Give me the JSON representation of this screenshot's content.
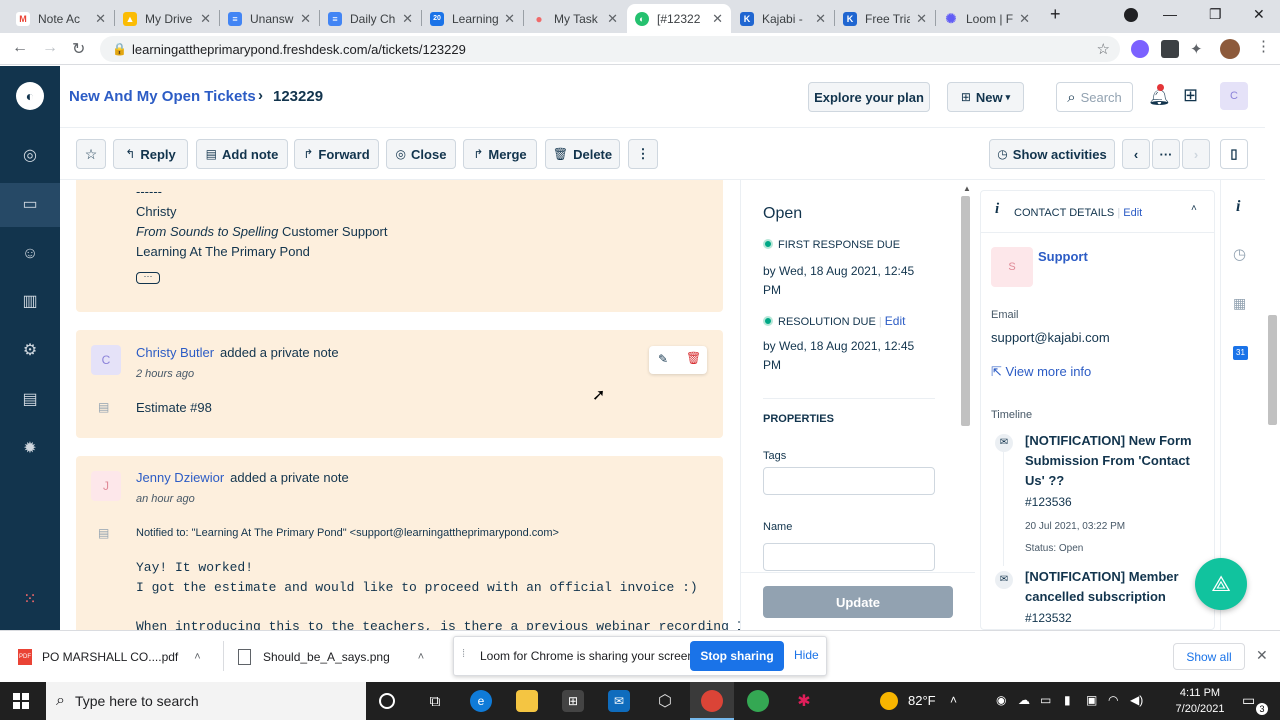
{
  "browser": {
    "tabs": [
      {
        "title": "Note Ac",
        "fav_color": "#ea4335",
        "fav": "M"
      },
      {
        "title": "My Drive",
        "fav_color": "#fbbc04",
        "fav": "▲"
      },
      {
        "title": "Unansw",
        "fav_color": "#4285f4",
        "fav": "≡"
      },
      {
        "title": "Daily Ch",
        "fav_color": "#4285f4",
        "fav": "≡"
      },
      {
        "title": "Learning",
        "fav_color": "#1a73e8",
        "fav": "20"
      },
      {
        "title": "My Task",
        "fav_color": "#f06a6a",
        "fav": "●"
      },
      {
        "title": "[#12322",
        "fav_color": "#25c16f",
        "fav": "◐"
      },
      {
        "title": "Kajabi -",
        "fav_color": "#2066d1",
        "fav": "K"
      },
      {
        "title": "Free Tria",
        "fav_color": "#2066d1",
        "fav": "K"
      },
      {
        "title": "Loom | F",
        "fav_color": "#625df5",
        "fav": "✺"
      }
    ],
    "url": "learningattheprimarypond.freshdesk.com/a/tickets/123229"
  },
  "header": {
    "breadcrumb": "New And My Open Tickets",
    "ticket_id": "123229",
    "explore_plan": "Explore your plan",
    "new_label": "New",
    "search_label": "Search",
    "avatar_letter": "C"
  },
  "toolbar": {
    "reply": "Reply",
    "add_note": "Add note",
    "forward": "Forward",
    "close": "Close",
    "merge": "Merge",
    "delete": "Delete",
    "show_activities": "Show activities"
  },
  "conversation": {
    "sig_dashes": "------",
    "sig_name": "Christy",
    "sig_line2_italic": "From Sounds to Spelling",
    "sig_line2_rest": " Customer Support",
    "sig_line3": "Learning At The Primary Pond",
    "notes": [
      {
        "author": "Christy Butler",
        "action": "added a private note",
        "time": "2 hours ago",
        "avatar": "C",
        "body": "Estimate #98"
      },
      {
        "author": "Jenny Dziewior",
        "action": "added a private note",
        "time": "an hour ago",
        "avatar": "J",
        "notified_label": "Notified to:",
        "notified_value": "\"Learning At The Primary Pond\" <support@learningattheprimarypond.com>",
        "line1": "Yay!  It worked!",
        "line2": "I got the estimate and would like to proceed with an official invoice :)",
        "line3": "When introducing this to the teachers, is there a previous webinar recording I"
      }
    ]
  },
  "properties": {
    "status": "Open",
    "first_response_label": "FIRST RESPONSE DUE",
    "first_response_value": "by Wed, 18 Aug 2021, 12:45 PM",
    "resolution_label": "RESOLUTION DUE",
    "resolution_edit": "Edit",
    "resolution_value": "by Wed, 18 Aug 2021, 12:45 PM",
    "section": "PROPERTIES",
    "tags_label": "Tags",
    "name_label": "Name",
    "update": "Update"
  },
  "contact": {
    "title": "CONTACT DETAILS",
    "edit": "Edit",
    "avatar": "S",
    "name": "Support",
    "email_label": "Email",
    "email": "support@kajabi.com",
    "view_more": "View more info",
    "timeline_label": "Timeline",
    "timeline": [
      {
        "title": "[NOTIFICATION] New Form Submission From 'Contact Us' ??",
        "id": "#123536",
        "date": "20 Jul 2021, 03:22 PM",
        "status": "Status: Open"
      },
      {
        "title": "[NOTIFICATION] Member cancelled subscription",
        "id": "#123532"
      }
    ]
  },
  "downloads": {
    "file1": "PO MARSHALL CO....pdf",
    "file2": "Should_be_A_says.png",
    "show_all": "Show all"
  },
  "loom_bar": {
    "message": "Loom for Chrome is sharing your screen.",
    "stop": "Stop sharing",
    "hide": "Hide"
  },
  "taskbar": {
    "search_placeholder": "Type here to search",
    "weather": "82°F",
    "time": "4:11 PM",
    "date": "7/20/2021",
    "notif_count": "3"
  }
}
